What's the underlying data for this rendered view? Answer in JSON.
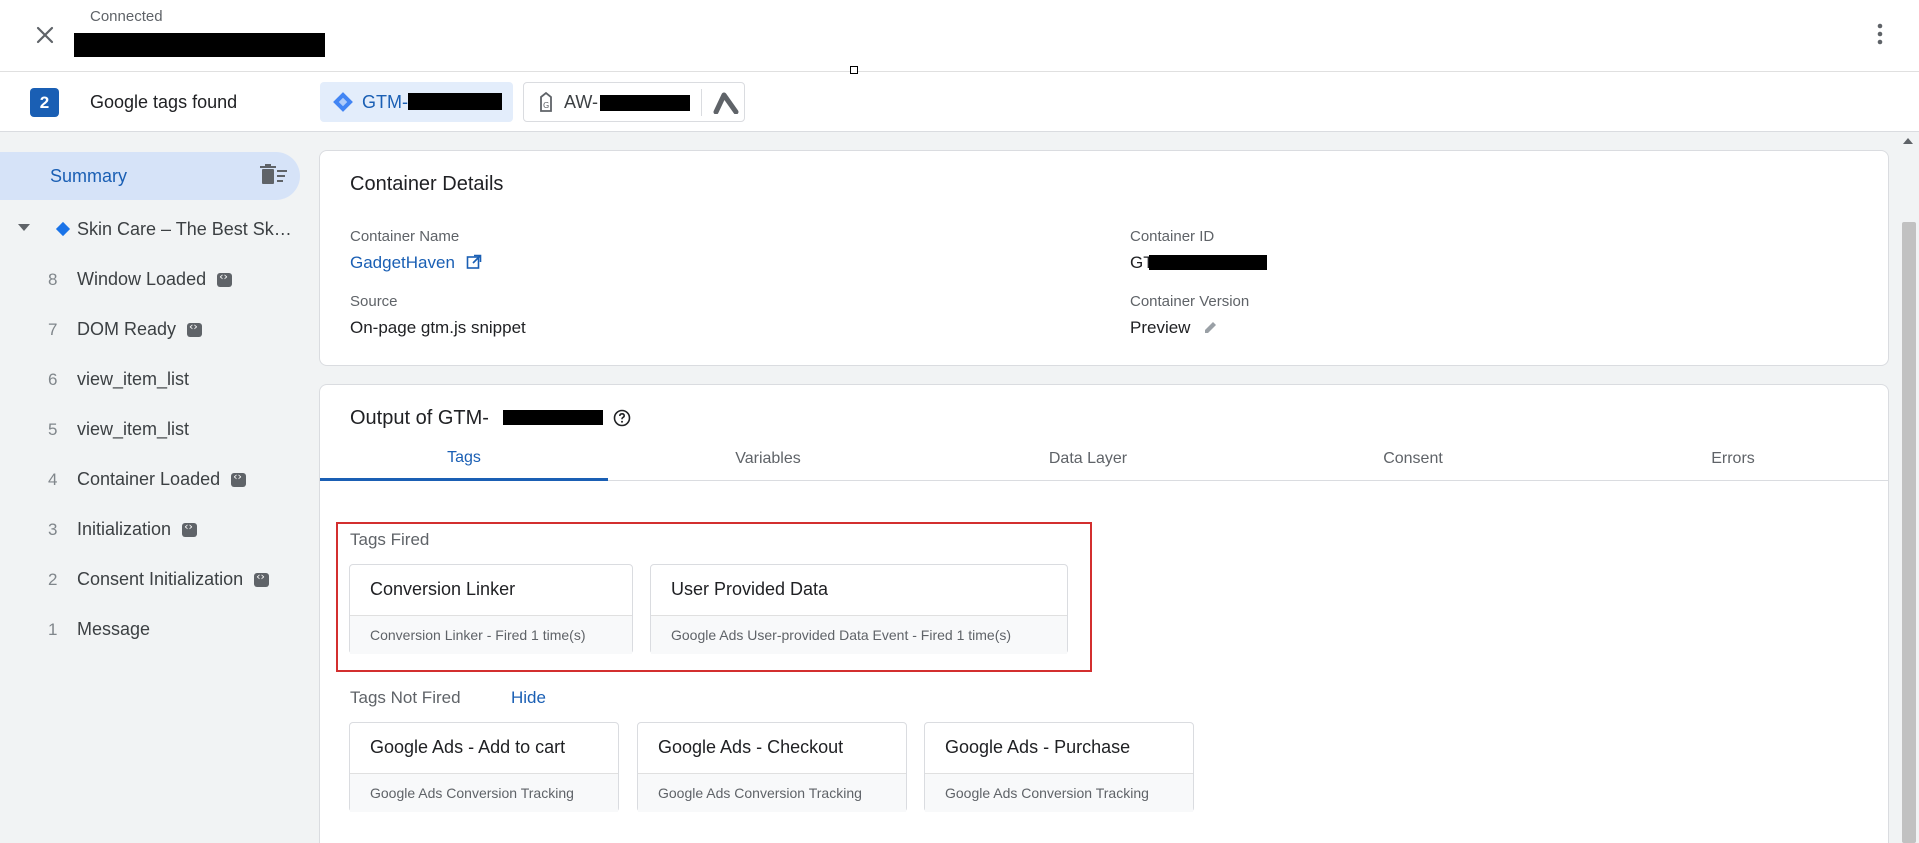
{
  "header": {
    "status": "Connected",
    "found_count": "2",
    "found_label": "Google tags found",
    "gtm_chip": "GTM-",
    "aw_chip": "AW-"
  },
  "sidebar": {
    "summary": "Summary",
    "page_title": "Skin Care – The Best Sk…",
    "events": [
      {
        "num": "8",
        "label": "Window Loaded",
        "code": true
      },
      {
        "num": "7",
        "label": "DOM Ready",
        "code": true
      },
      {
        "num": "6",
        "label": "view_item_list",
        "code": false
      },
      {
        "num": "5",
        "label": "view_item_list",
        "code": false
      },
      {
        "num": "4",
        "label": "Container Loaded",
        "code": true
      },
      {
        "num": "3",
        "label": "Initialization",
        "code": true
      },
      {
        "num": "2",
        "label": "Consent Initialization",
        "code": true
      },
      {
        "num": "1",
        "label": "Message",
        "code": false
      }
    ]
  },
  "container": {
    "title": "Container Details",
    "name_label": "Container Name",
    "name_value": "GadgetHaven",
    "id_label": "Container ID",
    "id_value": "GT",
    "source_label": "Source",
    "source_value": "On-page gtm.js snippet",
    "version_label": "Container Version",
    "version_value": "Preview"
  },
  "output": {
    "title": "Output of GTM-",
    "tabs": [
      "Tags",
      "Variables",
      "Data Layer",
      "Consent",
      "Errors"
    ],
    "fired_label": "Tags Fired",
    "fired": [
      {
        "name": "Conversion Linker",
        "detail": "Conversion Linker - Fired 1 time(s)"
      },
      {
        "name": "User Provided Data",
        "detail": "Google Ads User-provided Data Event - Fired 1 time(s)"
      }
    ],
    "not_fired_label": "Tags Not Fired",
    "hide_label": "Hide",
    "not_fired": [
      {
        "name": "Google Ads - Add to cart",
        "detail": "Google Ads Conversion Tracking"
      },
      {
        "name": "Google Ads - Checkout",
        "detail": "Google Ads Conversion Tracking"
      },
      {
        "name": "Google Ads - Purchase",
        "detail": "Google Ads Conversion Tracking"
      }
    ]
  },
  "colors": {
    "accent": "#1a5fb4",
    "highlight_border": "#d32f2f",
    "gtm_blue": "#4285f4"
  }
}
